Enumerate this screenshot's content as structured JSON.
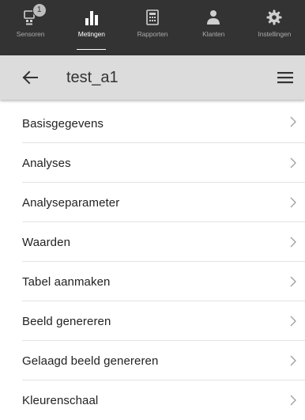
{
  "nav": {
    "items": [
      {
        "label": "Sensoren",
        "icon": "sensor-icon",
        "badge": "1",
        "active": false
      },
      {
        "label": "Metingen",
        "icon": "bar-chart-icon",
        "active": true
      },
      {
        "label": "Rapporten",
        "icon": "report-icon",
        "active": false
      },
      {
        "label": "Klanten",
        "icon": "person-icon",
        "active": false
      },
      {
        "label": "Instellingen",
        "icon": "gear-icon",
        "active": false
      }
    ]
  },
  "appbar": {
    "title": "test_a1",
    "back_icon": "arrow-left-icon",
    "menu_icon": "hamburger-menu-icon"
  },
  "menu": {
    "items": [
      {
        "label": "Basisgegevens"
      },
      {
        "label": "Analyses"
      },
      {
        "label": "Analyseparameter"
      },
      {
        "label": "Waarden"
      },
      {
        "label": "Tabel aanmaken"
      },
      {
        "label": "Beeld genereren"
      },
      {
        "label": "Gelaagd beeld genereren"
      },
      {
        "label": "Kleurenschaal"
      }
    ]
  },
  "colors": {
    "nav_bg": "#333333",
    "appbar_bg": "#dcdcdc",
    "text": "#222222",
    "chevron": "#9e9e9e"
  }
}
